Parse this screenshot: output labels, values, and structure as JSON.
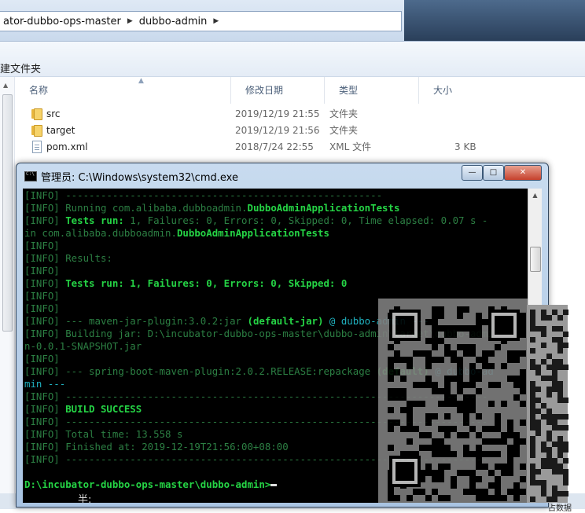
{
  "explorer": {
    "breadcrumb": [
      "ator-dubbo-ops-master",
      "dubbo-admin"
    ],
    "toolbar_new_folder": "建文件夹",
    "columns": {
      "name": "名称",
      "date": "修改日期",
      "type": "类型",
      "size": "大小"
    },
    "files": [
      {
        "name": "src",
        "date": "2019/12/19 21:55",
        "type": "文件夹",
        "size": "",
        "icon": "folder-icon"
      },
      {
        "name": "target",
        "date": "2019/12/19 21:56",
        "type": "文件夹",
        "size": "",
        "icon": "folder-icon"
      },
      {
        "name": "pom.xml",
        "date": "2018/7/24 22:55",
        "type": "XML 文件",
        "size": "3 KB",
        "icon": "xml-file-icon"
      }
    ],
    "corner_text": "占数据"
  },
  "cmd": {
    "title": "管理员: C:\\Windows\\system32\\cmd.exe",
    "buttons": {
      "minimize": "—",
      "maximize": "□",
      "close": "✕"
    },
    "lines": [
      {
        "p": "[INFO] ",
        "t": "------------------------------------------------------"
      },
      {
        "p": "[INFO] ",
        "t": "Running com.alibaba.dubboadmin.",
        "h": "DubboAdminApplicationTests"
      },
      {
        "p": "[INFO] ",
        "h": "Tests run: ",
        "t": "1, Failures: 0, Errors: 0, Skipped: 0, Time elapsed: 0.07 s -"
      },
      {
        "p": "",
        "t": "in com.alibaba.dubboadmin.",
        "h": "DubboAdminApplicationTests"
      },
      {
        "p": "[INFO] ",
        "t": ""
      },
      {
        "p": "[INFO] ",
        "t": "Results:"
      },
      {
        "p": "[INFO] ",
        "t": ""
      },
      {
        "p": "[INFO] ",
        "h": "Tests run: 1, Failures: 0, Errors: 0, Skipped: 0"
      },
      {
        "p": "[INFO] ",
        "t": ""
      },
      {
        "p": "[INFO] ",
        "t": ""
      },
      {
        "p": "[INFO] ",
        "t": "--- maven-jar-plugin:3.0.2:jar ",
        "h": "(default-jar)",
        "c": " @ dubbo-admin ---"
      },
      {
        "p": "[INFO] ",
        "t": "Building jar: D:\\incubator-dubbo-ops-master\\dubbo-admin\\target\\dubbo-admi"
      },
      {
        "p": "",
        "t": "n-0.0.1-SNAPSHOT.jar"
      },
      {
        "p": "[INFO] ",
        "t": ""
      },
      {
        "p": "[INFO] ",
        "t": "--- spring-boot-maven-plugin:2.0.2.RELEASE:repackage ",
        "h": "(default)",
        "c": " @ dubbo-ad"
      },
      {
        "p": "",
        "c": "min ---"
      },
      {
        "p": "[INFO] ",
        "t": "------------------------------------------------------------------------"
      },
      {
        "p": "[INFO] ",
        "h": "BUILD SUCCESS"
      },
      {
        "p": "[INFO] ",
        "t": "------------------------------------------------------------------------"
      },
      {
        "p": "[INFO] ",
        "t": "Total time: 13.558 s"
      },
      {
        "p": "[INFO] ",
        "t": "Finished at: 2019-12-19T21:56:00+08:00"
      },
      {
        "p": "[INFO] ",
        "t": "------------------------------------------------------------------------"
      },
      {
        "p": "",
        "t": ""
      },
      {
        "p": "",
        "prompt": "D:\\incubator-dubbo-ops-master\\dubbo-admin>"
      }
    ],
    "ime_indicator": "半:"
  }
}
